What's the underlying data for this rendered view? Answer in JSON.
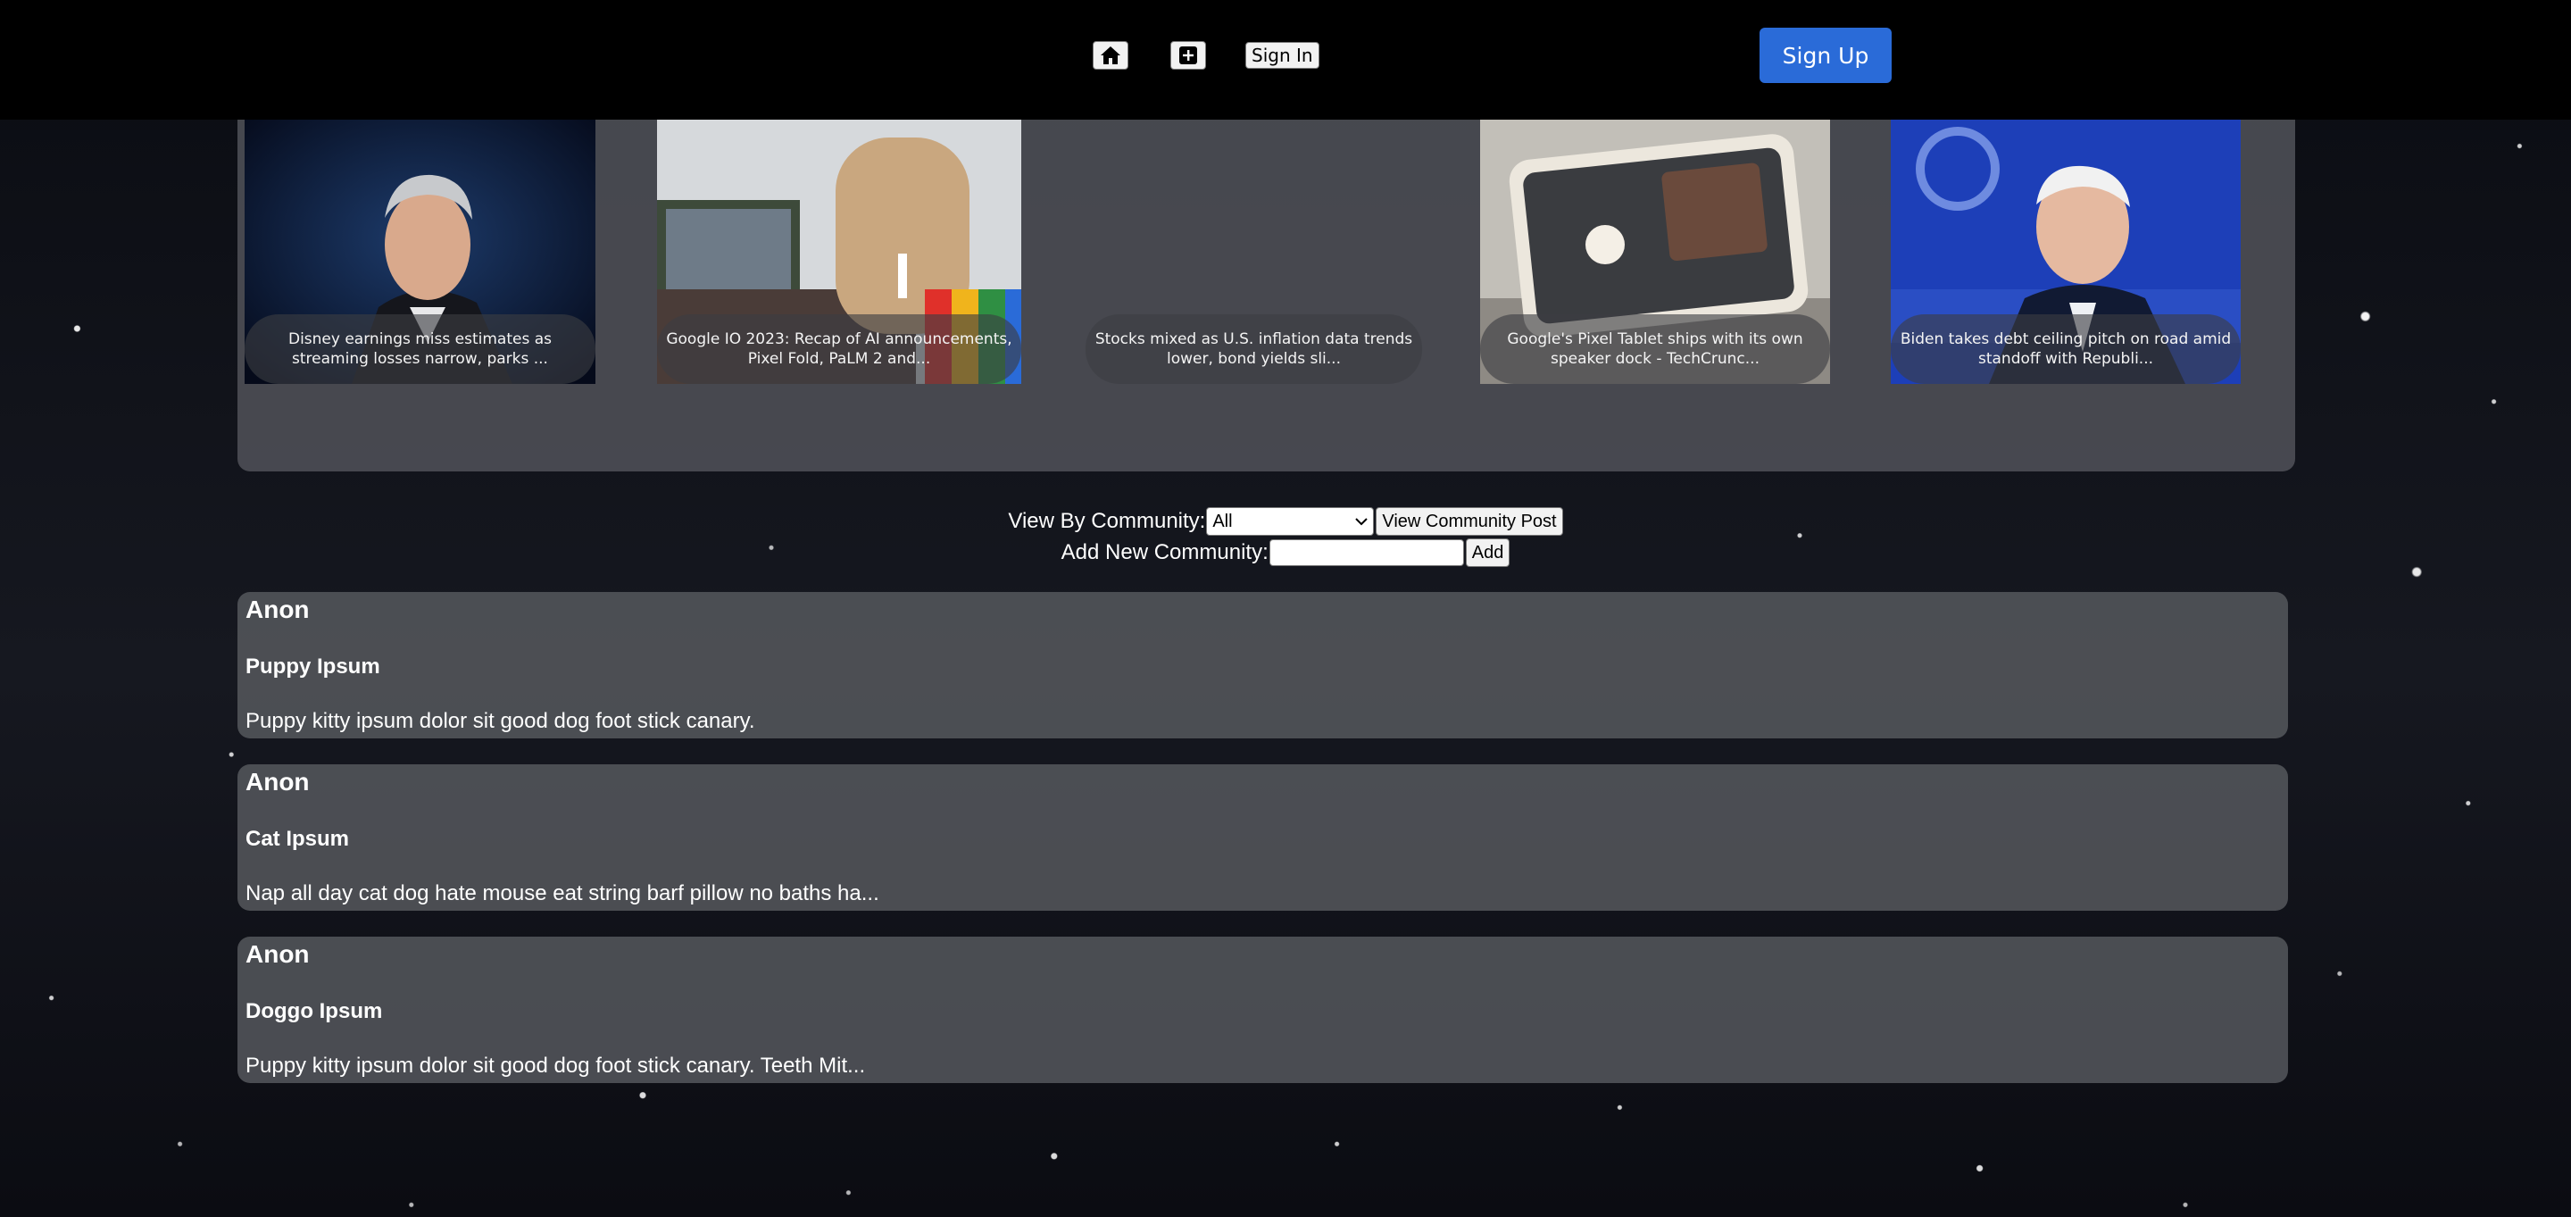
{
  "header": {
    "home_icon": "home-icon",
    "create_icon": "plus-square-icon",
    "sign_in_label": "Sign In",
    "sign_up_label": "Sign Up",
    "sign_up_color": "#2a6bd8"
  },
  "news": [
    {
      "caption": "Disney earnings miss estimates as streaming losses narrow, parks ..."
    },
    {
      "caption": "Google IO 2023: Recap of AI announcements, Pixel Fold, PaLM 2 and..."
    },
    {
      "caption": "Stocks mixed as U.S. inflation data trends lower, bond yields sli..."
    },
    {
      "caption": "Google's Pixel Tablet ships with its own speaker dock - TechCrunc..."
    },
    {
      "caption": "Biden takes debt ceiling pitch on road amid standoff with Republi..."
    }
  ],
  "community": {
    "view_label": "View By Community:",
    "selected_option": "All",
    "view_button": "View Community Post",
    "add_label": "Add New Community:",
    "add_input_value": "",
    "add_button": "Add"
  },
  "posts": [
    {
      "author": "Anon",
      "title": "Puppy Ipsum",
      "body": "Puppy kitty ipsum dolor sit good dog foot stick canary."
    },
    {
      "author": "Anon",
      "title": "Cat Ipsum",
      "body": "Nap all day cat dog hate mouse eat string barf pillow no baths ha..."
    },
    {
      "author": "Anon",
      "title": "Doggo Ipsum",
      "body": "Puppy kitty ipsum dolor sit good dog foot stick canary. Teeth Mit..."
    }
  ]
}
